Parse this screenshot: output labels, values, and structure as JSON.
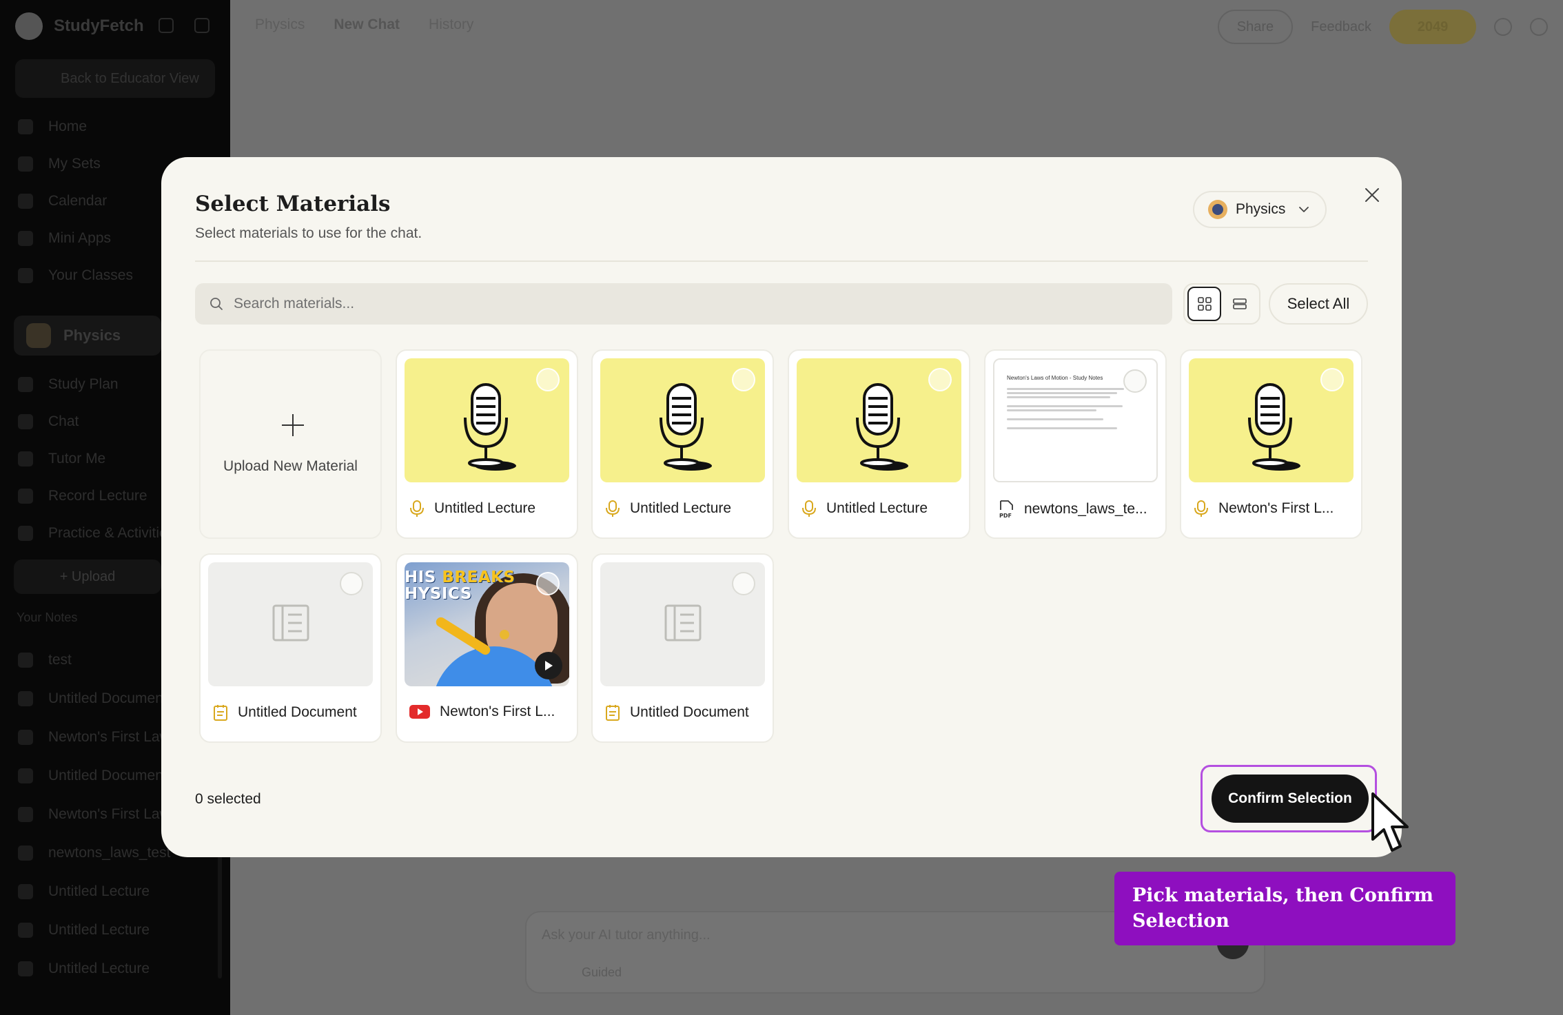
{
  "app": {
    "name": "StudyFetch",
    "back_label": "Back to Educator View",
    "nav": [
      "Home",
      "My Sets",
      "Calendar",
      "Mini Apps",
      "Your Classes"
    ],
    "course_name": "Physics",
    "course_nav": [
      "Study Plan",
      "Chat",
      "Tutor Me",
      "Record Lecture",
      "Practice & Activities"
    ],
    "upload_label": "+ Upload",
    "your_notes_label": "Your Notes",
    "notes": [
      "test",
      "Untitled Document",
      "Newton's First Law",
      "Untitled Document",
      "Newton's First Law",
      "newtons_laws_test",
      "Untitled Lecture",
      "Untitled Lecture",
      "Untitled Lecture"
    ]
  },
  "topbar": {
    "crumb_course": "Physics",
    "crumb_chat": "New Chat",
    "crumb_history": "History",
    "share": "Share",
    "feedback": "Feedback",
    "credits": "2049"
  },
  "chat": {
    "placeholder": "Ask your AI tutor anything...",
    "mode": "Guided"
  },
  "modal": {
    "title": "Select Materials",
    "subtitle": "Select materials to use for the chat.",
    "course_selector": "Physics",
    "search_placeholder": "Search materials...",
    "select_all": "Select All",
    "upload_label": "Upload New Material",
    "selected_count": "0 selected",
    "confirm_label": "Confirm Selection",
    "pdf_preview_title": "Newton's Laws of Motion - Study Notes",
    "video_thumb_line1": "HIS",
    "video_thumb_line1_highlight": "BREAKS",
    "video_thumb_line2": "HYSICS",
    "materials": [
      {
        "title": "Untitled Lecture",
        "type": "lecture"
      },
      {
        "title": "Untitled Lecture",
        "type": "lecture"
      },
      {
        "title": "Untitled Lecture",
        "type": "lecture"
      },
      {
        "title": "newtons_laws_te...",
        "type": "pdf"
      },
      {
        "title": "Newton's First L...",
        "type": "lecture"
      },
      {
        "title": "Untitled Document",
        "type": "document"
      },
      {
        "title": "Newton's First L...",
        "type": "video"
      },
      {
        "title": "Untitled Document",
        "type": "document"
      }
    ]
  },
  "tooltip": {
    "text": "Pick materials, then Confirm Selection"
  },
  "colors": {
    "accent_yellow": "#f6f08c",
    "tooltip_purple": "#8e0fbf",
    "highlight_border": "#b44fe0",
    "confirm_button": "#141414",
    "youtube_red": "#e32b2b"
  }
}
